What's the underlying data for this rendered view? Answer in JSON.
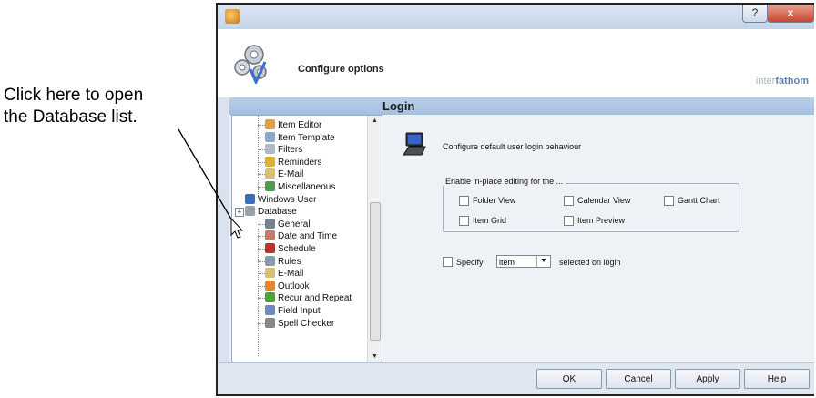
{
  "callout": {
    "line1": "Click here to open",
    "line2": "the Database list."
  },
  "window": {
    "title_buttons": {
      "help": "?",
      "close": "x"
    },
    "header_title": "Configure options",
    "brand": {
      "part1": "inter",
      "part2": "fathom"
    },
    "section_title": "Login"
  },
  "tree": {
    "items": [
      {
        "label": "Item Editor",
        "icon": "item-editor-icon",
        "color": "#e0a040"
      },
      {
        "label": "Item Template",
        "icon": "item-template-icon",
        "color": "#8aa8d0"
      },
      {
        "label": "Filters",
        "icon": "filters-icon",
        "color": "#b0b8c4"
      },
      {
        "label": "Reminders",
        "icon": "reminders-icon",
        "color": "#e0b030"
      },
      {
        "label": "E-Mail",
        "icon": "email-icon",
        "color": "#d8c070"
      },
      {
        "label": "Miscellaneous",
        "icon": "miscellaneous-icon",
        "color": "#4aa050"
      },
      {
        "label": "Windows User",
        "icon": "windows-user-icon",
        "color": "#3a6fc0"
      },
      {
        "label": "Database",
        "icon": "database-icon",
        "color": "#9aa0a8"
      },
      {
        "label": "General",
        "icon": "general-icon",
        "color": "#7a8090"
      },
      {
        "label": "Date and Time",
        "icon": "date-time-icon",
        "color": "#c87a6a"
      },
      {
        "label": "Schedule",
        "icon": "schedule-icon",
        "color": "#c03030"
      },
      {
        "label": "Rules",
        "icon": "rules-icon",
        "color": "#8a9ab0"
      },
      {
        "label": "E-Mail",
        "icon": "email-icon",
        "color": "#d8c070"
      },
      {
        "label": "Outlook",
        "icon": "outlook-icon",
        "color": "#e08a30"
      },
      {
        "label": "Recur and Repeat",
        "icon": "recur-icon",
        "color": "#50a040"
      },
      {
        "label": "Field Input",
        "icon": "field-input-icon",
        "color": "#6a8ac0"
      },
      {
        "label": "Spell Checker",
        "icon": "spell-checker-icon",
        "color": "#888888"
      }
    ],
    "expander": "+"
  },
  "panel": {
    "description": "Configure default user login behaviour",
    "group_legend": "Enable in-place editing for the ...",
    "options": [
      {
        "label": "Folder View",
        "checked": false
      },
      {
        "label": "Calendar View",
        "checked": false
      },
      {
        "label": "Gantt Chart",
        "checked": false
      },
      {
        "label": "Item Grid",
        "checked": false
      },
      {
        "label": "Item Preview",
        "checked": false
      }
    ],
    "specify": {
      "label": "Specify",
      "checked": false,
      "value": "item",
      "suffix": "selected on login"
    }
  },
  "footer": {
    "ok": "OK",
    "cancel": "Cancel",
    "apply": "Apply",
    "help": "Help"
  }
}
